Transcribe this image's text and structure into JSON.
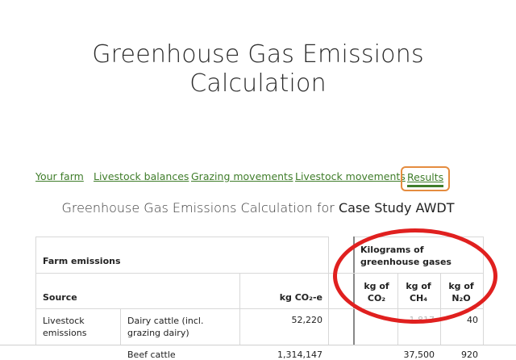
{
  "page": {
    "title_line1": "Greenhouse Gas Emissions",
    "title_line2": "Calculation"
  },
  "nav": {
    "items": [
      {
        "label": "Your farm"
      },
      {
        "label": "Livestock balances"
      },
      {
        "label": "Grazing movements"
      },
      {
        "label": "Livestock movements"
      },
      {
        "label": "Results"
      }
    ],
    "active": "Results"
  },
  "subtitle": {
    "prefix": "Greenhouse Gas Emissions Calculation for",
    "name": "Case Study AWDT"
  },
  "table": {
    "farm_emissions": "Farm emissions",
    "kg_group": "Kilograms of greenhouse gases",
    "col_source": "Source",
    "col_co2e": "kg CO₂-e",
    "col_co2": "kg of CO₂",
    "col_ch4": "kg of CH₄",
    "col_n2o": "kg of N₂O",
    "rows": [
      {
        "group": "Livestock emissions",
        "source": "Dairy cattle (incl. grazing dairy)",
        "co2e": "52,220",
        "ch4": "1,817",
        "n2o": "40"
      },
      {
        "group": "",
        "source": "Beef cattle",
        "co2e": "1,314,147",
        "ch4": "37,500",
        "n2o": "920"
      }
    ]
  },
  "colors": {
    "accent_green": "#3f7d2a",
    "active_border": "#e58c3f",
    "annotation_red": "#e0201f"
  }
}
